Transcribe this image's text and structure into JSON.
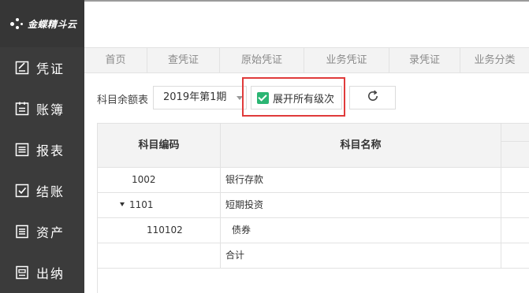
{
  "app": {
    "logo_text": "金蝶精斗云"
  },
  "sidebar": {
    "items": [
      {
        "label": "凭证",
        "icon": "voucher-icon"
      },
      {
        "label": "账簿",
        "icon": "ledger-icon"
      },
      {
        "label": "报表",
        "icon": "report-icon"
      },
      {
        "label": "结账",
        "icon": "checkout-icon"
      },
      {
        "label": "资产",
        "icon": "asset-icon"
      },
      {
        "label": "出纳",
        "icon": "cashier-icon"
      }
    ]
  },
  "tabs": [
    "首页",
    "查凭证",
    "原始凭证",
    "业务凭证",
    "录凭证",
    "业务分类"
  ],
  "toolbar": {
    "label": "科目余额表",
    "period_value": "2019年第1期",
    "expand_label": "展开所有级次",
    "expand_checked": true
  },
  "table": {
    "headers": {
      "code": "科目编码",
      "name": "科目名称"
    },
    "rows": [
      {
        "code": "1002",
        "name": "银行存款",
        "expandable": false,
        "indent": 0
      },
      {
        "code": "1101",
        "name": "短期投资",
        "expandable": true,
        "indent": 0
      },
      {
        "code": "110102",
        "name": "债券",
        "expandable": false,
        "indent": 1
      },
      {
        "code": "",
        "name": "合计",
        "expandable": false,
        "indent": 0
      }
    ]
  },
  "colors": {
    "sidebar_bg": "#3b3b3b",
    "accent_green": "#2bb573",
    "highlight_red": "#e03b3b"
  }
}
